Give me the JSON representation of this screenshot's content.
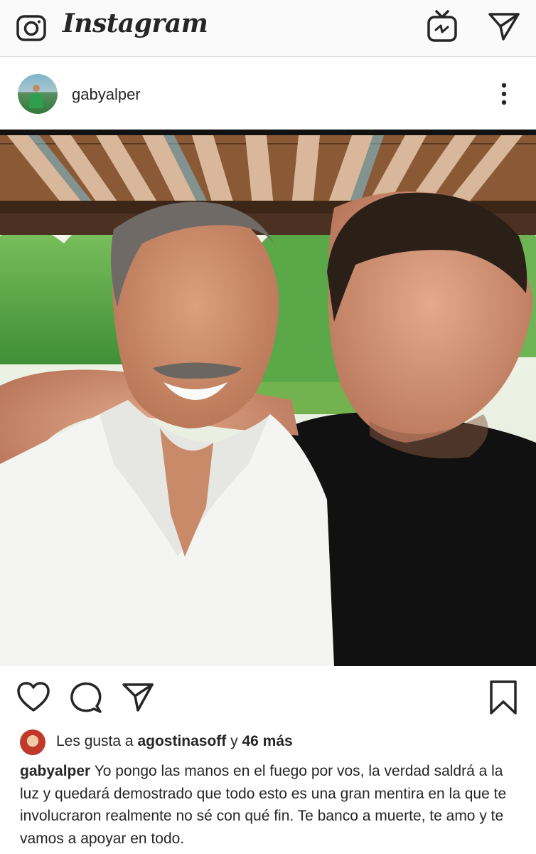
{
  "app": {
    "title": "Instagram",
    "icons": {
      "camera": "camera-icon",
      "igtv": "igtv-icon",
      "direct": "direct-message-icon"
    }
  },
  "post": {
    "username": "gabyalper",
    "menu_icon": "more-options-icon",
    "photo_alt": "",
    "actions": {
      "like": "heart-icon",
      "comment": "comment-icon",
      "share": "share-icon",
      "save": "bookmark-icon"
    },
    "likes": {
      "prefix": "Les gusta a",
      "user": "agostinasoff",
      "joiner": "y",
      "others": "46 más"
    },
    "caption": {
      "username": "gabyalper",
      "text": "Yo pongo las manos en el fuego por vos, la verdad saldrá a la luz y quedará demostrado que todo esto es una gran mentira en la que te involucraron realmente no sé con qué fin. Te banco a muerte, te amo y te vamos a apoyar en todo."
    }
  },
  "colors": {
    "text": "#262626",
    "bar_background": "#fafafa",
    "divider": "#dbdbdb"
  }
}
